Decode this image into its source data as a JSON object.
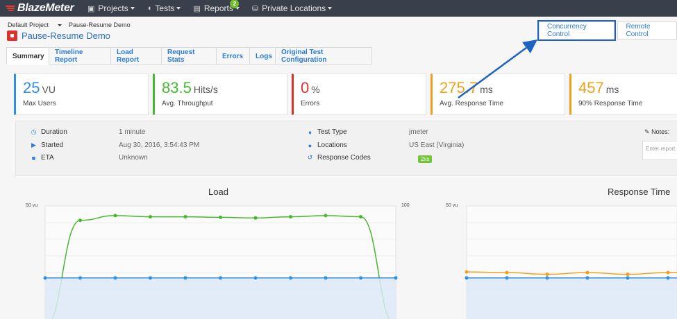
{
  "nav": {
    "brand": "BlazeMeter",
    "items": [
      {
        "label": "Projects",
        "icon": "folder-icon"
      },
      {
        "label": "Tests",
        "icon": "gauge-icon"
      },
      {
        "label": "Reports",
        "icon": "report-icon",
        "badge": "2"
      },
      {
        "label": "Private Locations",
        "icon": "database-icon"
      }
    ]
  },
  "breadcrumb": {
    "project": "Default Project",
    "test": "Pause-Resume Demo"
  },
  "page": {
    "title": "Pause-Resume Demo"
  },
  "actions": {
    "concurrency": "Concurrency Control",
    "remote": "Remote Control"
  },
  "tabs": [
    "Summary",
    "Timeline Report",
    "Load Report",
    "Request Stats",
    "Errors",
    "Logs",
    "Original Test Configuration"
  ],
  "kpis": [
    {
      "value": "25",
      "unit": "VU",
      "label": "Max Users",
      "color": "#2f8fe0"
    },
    {
      "value": "83.5",
      "unit": "Hits/s",
      "label": "Avg. Throughput",
      "color": "#45b82f"
    },
    {
      "value": "0",
      "unit": "%",
      "label": "Errors",
      "color": "#d9332c"
    },
    {
      "value": "275.7",
      "unit": "ms",
      "label": "Avg. Response Time",
      "color": "#f0a01a"
    },
    {
      "value": "457",
      "unit": "ms",
      "label": "90% Response Time",
      "color": "#f0a01a"
    }
  ],
  "info": {
    "duration_label": "Duration",
    "duration": "1 minute",
    "started_label": "Started",
    "started": "Aug 30, 2016, 3:54:43 PM",
    "eta_label": "ETA",
    "eta": "Unknown",
    "type_label": "Test Type",
    "type": "jmeter",
    "locations_label": "Locations",
    "locations": "US East (Virginia)",
    "codes_label": "Response Codes",
    "codes": "2xx",
    "notes_label": "Notes:",
    "notes_placeholder": "Enter report"
  },
  "charts": {
    "load_title": "Load",
    "load_left_label": "50 vu",
    "load_right_label": "100",
    "rt_title": "Response Time",
    "rt_left_label": "50 vu"
  },
  "chart_data": [
    {
      "type": "line",
      "title": "Load",
      "x": [
        0,
        1,
        2,
        3,
        4,
        5,
        6,
        7,
        8,
        9,
        10
      ],
      "series": [
        {
          "color": "#45b82f",
          "values": [
            0,
            88,
            92,
            91,
            91,
            90.5,
            90,
            91,
            92,
            91,
            0
          ]
        },
        {
          "color": "#2f8fe0",
          "values": [
            40,
            40,
            40,
            40,
            40,
            40,
            40,
            40,
            40,
            40,
            40
          ]
        }
      ],
      "ylim": [
        0,
        100
      ]
    },
    {
      "type": "line",
      "title": "Response Time",
      "x": [
        0,
        1,
        2,
        3,
        4,
        5,
        6
      ],
      "series": [
        {
          "color": "#f0a01a",
          "values": [
            45,
            44.5,
            43,
            44.5,
            43,
            44.5,
            45
          ]
        },
        {
          "color": "#2f8fe0",
          "values": [
            40,
            40,
            40,
            40,
            40,
            40,
            40
          ]
        }
      ],
      "ylim": [
        0,
        100
      ]
    }
  ]
}
